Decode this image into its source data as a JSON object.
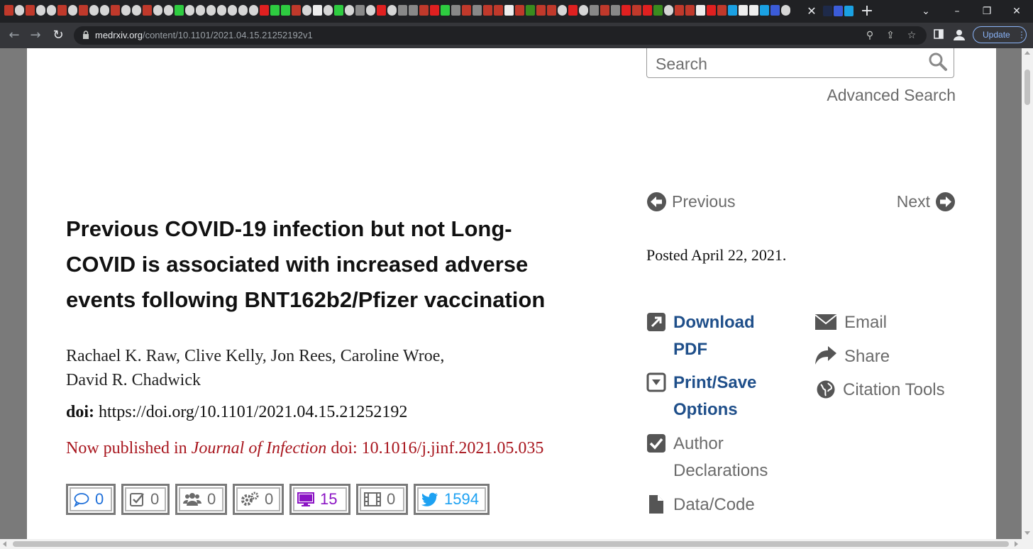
{
  "browser": {
    "url_host": "medrxiv.org",
    "url_path": "/content/10.1101/2021.04.15.21252192v1",
    "update_label": "Update",
    "tab_close": "✕",
    "new_tab": "+",
    "tab_icons": [
      "B",
      "C",
      "B",
      "C",
      "C",
      "B",
      "C",
      "B",
      "C",
      "C",
      "B",
      "C",
      "C",
      "B",
      "C",
      "C",
      "D",
      "C",
      "C",
      "C",
      "C",
      "C",
      "C",
      "C",
      "Y",
      "D",
      "D",
      "B",
      "C",
      "W",
      "C",
      "D",
      "C",
      "G",
      "C",
      "Y",
      "C",
      "G",
      "G",
      "B",
      "Y",
      "D",
      "G",
      "B",
      "G",
      "B",
      "B",
      "W",
      "B",
      "g",
      "B",
      "B",
      "C",
      "Y",
      "C",
      "G",
      "B",
      "G",
      "Y",
      "B",
      "Y",
      "g",
      "C",
      "B",
      "B",
      "W",
      "Y",
      "B",
      "Q",
      "W",
      "W",
      "Q",
      "S",
      "C"
    ],
    "tab_icons_right": [
      "X",
      "S",
      "Q"
    ]
  },
  "search": {
    "placeholder": "Search",
    "advanced_label": "Advanced Search"
  },
  "nav": {
    "previous_label": "Previous",
    "next_label": "Next"
  },
  "article": {
    "title": "Previous COVID-19 infection but not Long-COVID is associated with increased adverse events following BNT162b2/Pfizer vaccination",
    "authors_line1": "Rachael K. Raw, Clive Kelly, Jon Rees, Caroline Wroe,",
    "authors_line2": "David R. Chadwick",
    "doi_label": "doi:",
    "doi_value": "https://doi.org/10.1101/2021.04.15.21252192",
    "published_prefix": "Now published in",
    "published_journal": "Journal of Infection",
    "published_doi": "doi: 10.1016/j.jinf.2021.05.035",
    "posted": "Posted April 22, 2021."
  },
  "metrics": [
    {
      "name": "comments",
      "icon": "comment-icon",
      "value": "0",
      "color": "#1e6fd9"
    },
    {
      "name": "reviews",
      "icon": "checkbox-icon",
      "value": "0",
      "color": "#6b6b6b"
    },
    {
      "name": "community",
      "icon": "users-icon",
      "value": "0",
      "color": "#6b6b6b"
    },
    {
      "name": "automated-tools",
      "icon": "gears-icon",
      "value": "0",
      "color": "#6b6b6b"
    },
    {
      "name": "blogs",
      "icon": "monitor-icon",
      "value": "15",
      "color": "#8b14c4"
    },
    {
      "name": "media",
      "icon": "film-icon",
      "value": "0",
      "color": "#6b6b6b"
    },
    {
      "name": "twitter",
      "icon": "twitter-icon",
      "value": "1594",
      "color": "#1da1f2"
    }
  ],
  "actions": {
    "download_line1": "Download",
    "download_line2": "PDF",
    "print_line1": "Print/Save",
    "print_line2": "Options",
    "author_line1": "Author",
    "author_line2": "Declarations",
    "data_code": "Data/Code",
    "email": "Email",
    "share": "Share",
    "citation": "Citation Tools"
  }
}
